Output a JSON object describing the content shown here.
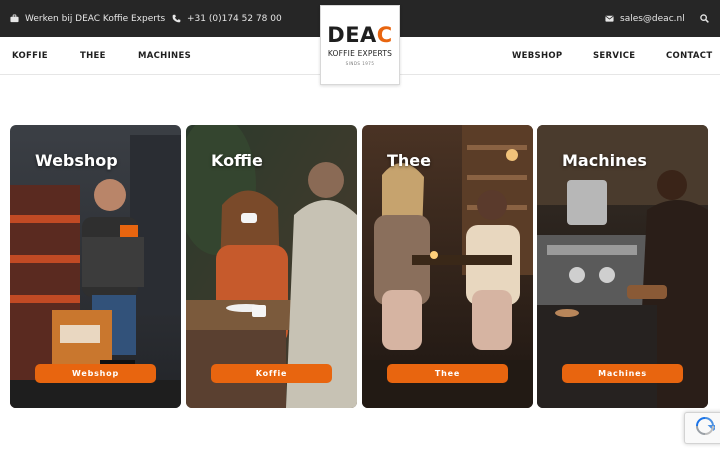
{
  "topbar": {
    "work_text": "Werken bij DEAC Koffie Experts",
    "work_icon": "briefcase-icon",
    "phone_text": "+31 (0)174 52 78 00",
    "phone_icon": "phone-icon",
    "email_text": "sales@deac.nl",
    "email_icon": "envelope-icon",
    "search_icon": "search-icon"
  },
  "logo": {
    "brand_pre": "DEA",
    "brand_accent": "C",
    "subtitle": "KOFFIE EXPERTS",
    "since": "SINDS 1975"
  },
  "nav": {
    "left": [
      "KOFFIE",
      "THEE",
      "MACHINES"
    ],
    "right": [
      "WEBSHOP",
      "SERVICE",
      "CONTACT"
    ]
  },
  "cards": [
    {
      "title": "Webshop",
      "button": "Webshop"
    },
    {
      "title": "Koffie",
      "button": "Koffie"
    },
    {
      "title": "Thee",
      "button": "Thee"
    },
    {
      "title": "Machines",
      "button": "Machines"
    }
  ],
  "colors": {
    "accent": "#e8650f",
    "topbar_bg": "#262626"
  },
  "recaptcha_icon": "recaptcha-icon"
}
